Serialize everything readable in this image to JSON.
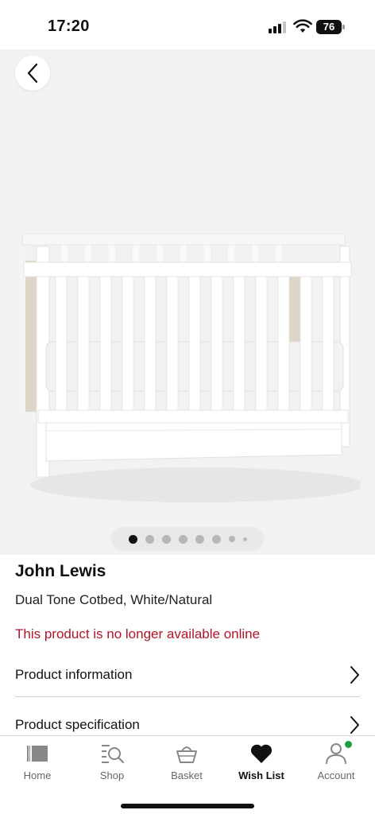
{
  "status_bar": {
    "time": "17:20",
    "battery": "76"
  },
  "gallery": {
    "image_count": 8,
    "active_index": 0
  },
  "product": {
    "brand": "John Lewis",
    "title": "Dual Tone Cotbed, White/Natural",
    "availability": "This product is no longer available online"
  },
  "sections": [
    {
      "label": "Product information"
    },
    {
      "label": "Product specification"
    }
  ],
  "tabbar": {
    "items": [
      {
        "label": "Home",
        "icon": "home-icon"
      },
      {
        "label": "Shop",
        "icon": "search-icon"
      },
      {
        "label": "Basket",
        "icon": "basket-icon"
      },
      {
        "label": "Wish List",
        "icon": "heart-icon",
        "active": true
      },
      {
        "label": "Account",
        "icon": "account-icon",
        "badge": true
      }
    ]
  },
  "colors": {
    "alert": "#b3152a",
    "badge": "#1e9e3f",
    "active": "#111111"
  }
}
